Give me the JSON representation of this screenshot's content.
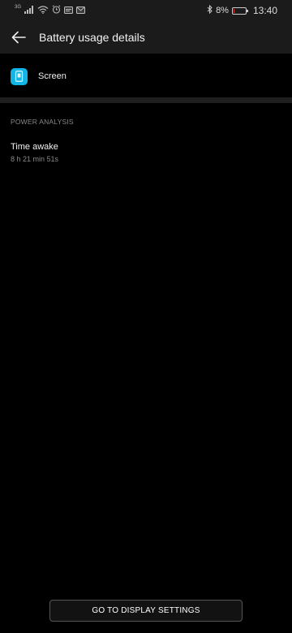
{
  "status_bar": {
    "network": "3G",
    "battery_percent_label": "8%",
    "battery_level": 0.08,
    "time": "13:40",
    "icons": [
      "signal-icon",
      "wifi-icon",
      "alarm-icon",
      "notification-icon",
      "mail-icon",
      "bluetooth-icon",
      "battery-icon"
    ]
  },
  "app_bar": {
    "back_icon": "back-arrow-icon",
    "title": "Battery usage details"
  },
  "app": {
    "icon": "screen-icon",
    "label": "Screen",
    "icon_color": "#11b5e6"
  },
  "power_analysis": {
    "header": "POWER ANALYSIS",
    "items": [
      {
        "title": "Time awake",
        "value": "8 h 21 min 51s"
      }
    ]
  },
  "footer": {
    "button_label": "GO TO DISPLAY SETTINGS"
  }
}
